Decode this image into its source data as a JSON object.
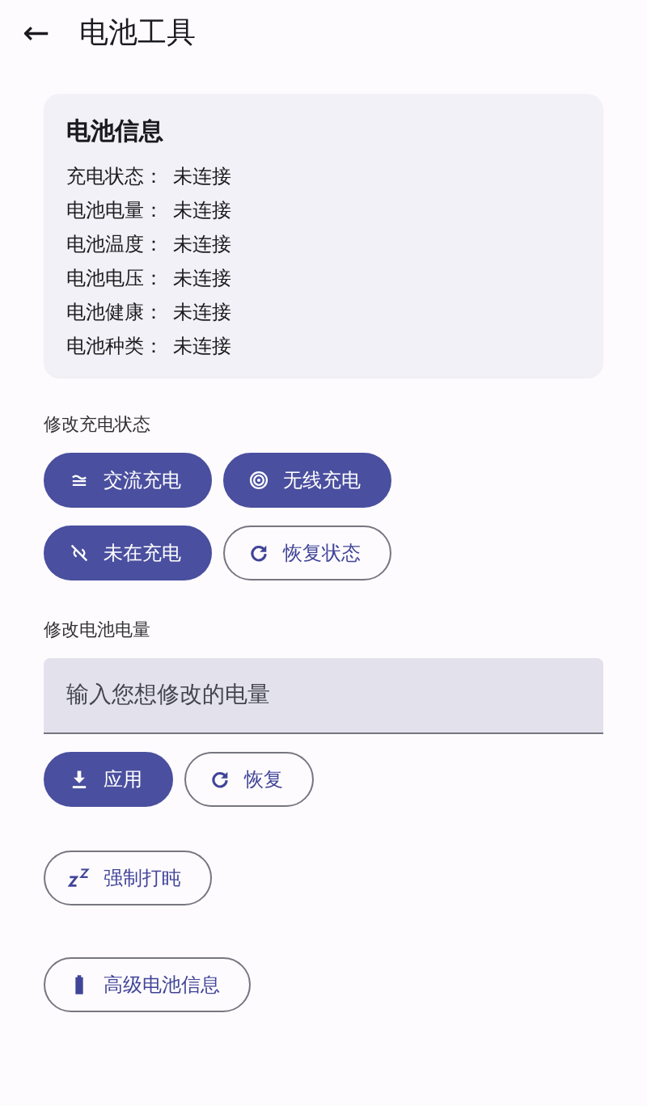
{
  "app_bar": {
    "back_icon": "←",
    "title": "电池工具"
  },
  "battery_info": {
    "title": "电池信息",
    "rows": [
      {
        "label": "充电状态：",
        "value": "未连接"
      },
      {
        "label": "电池电量：",
        "value": "未连接"
      },
      {
        "label": "电池温度：",
        "value": "未连接"
      },
      {
        "label": "电池电压：",
        "value": "未连接"
      },
      {
        "label": "电池健康：",
        "value": "未连接"
      },
      {
        "label": "电池种类：",
        "value": "未连接"
      }
    ]
  },
  "charge_section": {
    "label": "修改充电状态",
    "rows": [
      [
        {
          "label": "交流充电",
          "kind": "filled"
        },
        {
          "label": "无线充电",
          "kind": "filled"
        }
      ],
      [
        {
          "label": "未在充电",
          "kind": "filled"
        },
        {
          "label": "恢复状态",
          "kind": "outlined"
        }
      ]
    ]
  },
  "level_section": {
    "label": "修改电池电量",
    "input": {
      "placeholder": "输入您想修改的电量"
    },
    "buttons": [
      {
        "label": "应用",
        "kind": "filled"
      },
      {
        "label": "恢复",
        "kind": "outlined"
      }
    ]
  },
  "extra_buttons": [
    {
      "label": "强制打盹",
      "kind": "outlined"
    },
    {
      "label": "高级电池信息",
      "kind": "outlined"
    }
  ]
}
